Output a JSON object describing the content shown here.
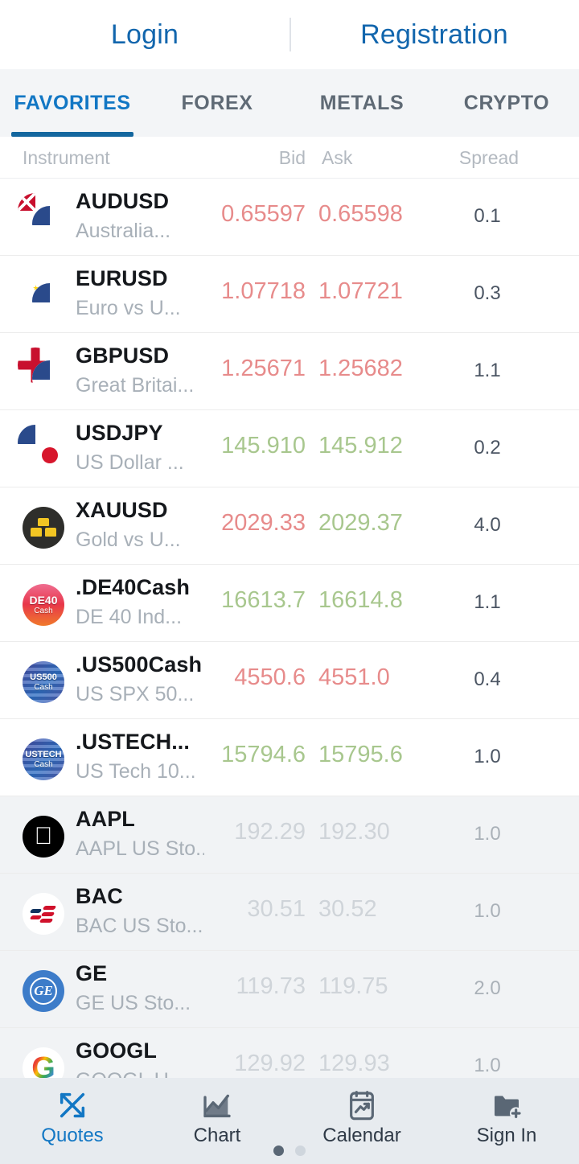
{
  "auth": {
    "login_label": "Login",
    "registration_label": "Registration"
  },
  "tabs": [
    {
      "label": "FAVORITES",
      "active": true
    },
    {
      "label": "FOREX",
      "active": false
    },
    {
      "label": "METALS",
      "active": false
    },
    {
      "label": "CRYPTO",
      "active": false
    }
  ],
  "columns": {
    "instrument": "Instrument",
    "bid": "Bid",
    "ask": "Ask",
    "spread": "Spread"
  },
  "colors": {
    "accent_blue": "#1277c4",
    "link_blue": "#1266ad",
    "price_up": "#a8c78e",
    "price_down": "#e78b8b",
    "price_dim": "#cfd4d9",
    "tab_inactive": "#5f6a75",
    "closed_row_bg": "#f1f3f5"
  },
  "quotes": [
    {
      "icon": "flag-pair-aud-usd",
      "symbol": "AUDUSD",
      "description": "Australia...",
      "bid": "0.65597",
      "ask": "0.65598",
      "spread": "0.1",
      "bid_dir": "down",
      "ask_dir": "down",
      "closed": false
    },
    {
      "icon": "flag-pair-eur-usd",
      "symbol": "EURUSD",
      "description": "Euro vs U...",
      "bid": "1.07718",
      "ask": "1.07721",
      "spread": "0.3",
      "bid_dir": "down",
      "ask_dir": "down",
      "closed": false
    },
    {
      "icon": "flag-pair-gbp-usd",
      "symbol": "GBPUSD",
      "description": "Great Britai...",
      "bid": "1.25671",
      "ask": "1.25682",
      "spread": "1.1",
      "bid_dir": "down",
      "ask_dir": "down",
      "closed": false
    },
    {
      "icon": "flag-pair-usd-jpy",
      "symbol": "USDJPY",
      "description": "US Dollar ...",
      "bid": "145.910",
      "ask": "145.912",
      "spread": "0.2",
      "bid_dir": "up",
      "ask_dir": "up",
      "closed": false
    },
    {
      "icon": "gold-bars-icon",
      "symbol": "XAUUSD",
      "description": "Gold vs U...",
      "bid": "2029.33",
      "ask": "2029.37",
      "spread": "4.0",
      "bid_dir": "down",
      "ask_dir": "up",
      "closed": false
    },
    {
      "icon": "de40-cash-icon",
      "symbol": ".DE40Cash",
      "description": "DE 40 Ind...",
      "bid": "16613.7",
      "ask": "16614.8",
      "spread": "1.1",
      "bid_dir": "up",
      "ask_dir": "up",
      "closed": false
    },
    {
      "icon": "us500-cash-icon",
      "symbol": ".US500Cash",
      "description": "US SPX 50...",
      "bid": "4550.6",
      "ask": "4551.0",
      "spread": "0.4",
      "bid_dir": "down",
      "ask_dir": "down",
      "closed": false
    },
    {
      "icon": "ustech-cash-icon",
      "symbol": ".USTECH...",
      "description": "US Tech 10...",
      "bid": "15794.6",
      "ask": "15795.6",
      "spread": "1.0",
      "bid_dir": "up",
      "ask_dir": "up",
      "closed": false
    },
    {
      "icon": "apple-logo-icon",
      "symbol": "AAPL",
      "description": "AAPL US Sto...",
      "bid": "192.29",
      "ask": "192.30",
      "spread": "1.0",
      "bid_dir": "dim",
      "ask_dir": "dim",
      "closed": true
    },
    {
      "icon": "bac-logo-icon",
      "symbol": "BAC",
      "description": "BAC US Sto...",
      "bid": "30.51",
      "ask": "30.52",
      "spread": "1.0",
      "bid_dir": "dim",
      "ask_dir": "dim",
      "closed": true
    },
    {
      "icon": "ge-logo-icon",
      "symbol": "GE",
      "description": "GE US Sto...",
      "bid": "119.73",
      "ask": "119.75",
      "spread": "2.0",
      "bid_dir": "dim",
      "ask_dir": "dim",
      "closed": true
    },
    {
      "icon": "google-logo-icon",
      "symbol": "GOOGL",
      "description": "GOOGL U...",
      "bid": "129.92",
      "ask": "129.93",
      "spread": "1.0",
      "bid_dir": "dim",
      "ask_dir": "dim",
      "closed": true
    }
  ],
  "bottom_nav": [
    {
      "label": "Quotes",
      "icon": "quotes-arrows-icon",
      "active": true
    },
    {
      "label": "Chart",
      "icon": "chart-icon",
      "active": false
    },
    {
      "label": "Calendar",
      "icon": "calendar-chart-icon",
      "active": false
    },
    {
      "label": "Sign In",
      "icon": "folder-plus-icon",
      "active": false
    }
  ],
  "pager": {
    "total": 2,
    "current": 1
  }
}
